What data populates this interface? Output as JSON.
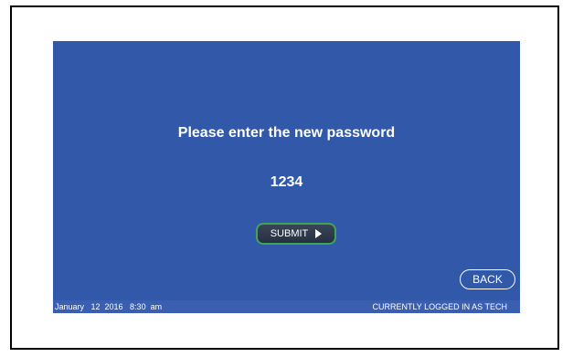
{
  "screen": {
    "prompt": "Please enter the new password",
    "password_value": "1234",
    "submit_label": "SUBMIT",
    "submit_icon": "play-triangle-icon",
    "back_label": "BACK"
  },
  "status_bar": {
    "date_time": "January   12  2016   8:30  am",
    "user_status": "CURRENTLY LOGGED IN AS TECH"
  },
  "colors": {
    "screen_background": "#3259a9",
    "submit_border": "#3fa45a",
    "text": "#ffffff"
  }
}
